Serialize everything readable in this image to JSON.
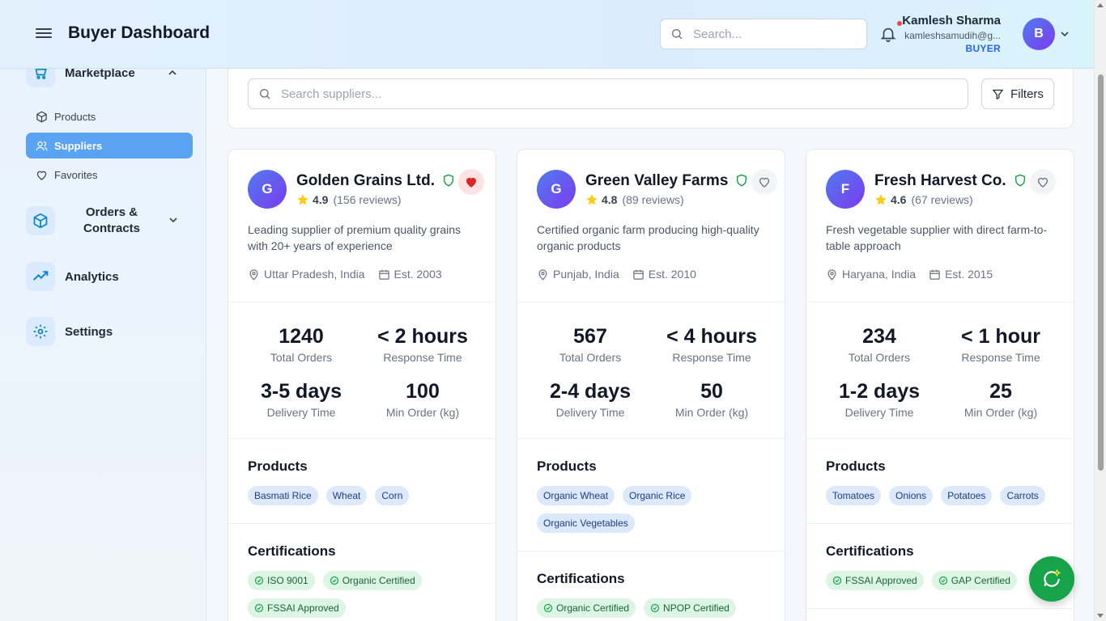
{
  "header": {
    "title": "Buyer Dashboard",
    "search_placeholder": "Search...",
    "user": {
      "name": "Kamlesh Sharma",
      "email": "kamleshsamudih@g...",
      "role": "BUYER",
      "initial": "B"
    }
  },
  "sidebar": {
    "marketplace": "Marketplace",
    "sub_items": [
      {
        "label": "Products"
      },
      {
        "label": "Suppliers"
      },
      {
        "label": "Favorites"
      }
    ],
    "orders_line1": "Orders &",
    "orders_line2": "Contracts",
    "analytics": "Analytics",
    "settings": "Settings"
  },
  "main": {
    "search_placeholder": "Search suppliers...",
    "filters_label": "Filters",
    "suppliers": [
      {
        "initial": "G",
        "name": "Golden Grains Ltd.",
        "rating": "4.9",
        "reviews": "(156 reviews)",
        "description": "Leading supplier of premium quality grains with 20+ years of experience",
        "location": "Uttar Pradesh, India",
        "established": "Est. 2003",
        "favorited": true,
        "stats": [
          {
            "value": "1240",
            "label": "Total Orders"
          },
          {
            "value": "< 2 hours",
            "label": "Response Time"
          },
          {
            "value": "3-5 days",
            "label": "Delivery Time"
          },
          {
            "value": "100",
            "label": "Min Order (kg)"
          }
        ],
        "products_title": "Products",
        "products": [
          "Basmati Rice",
          "Wheat",
          "Corn"
        ],
        "certifications_title": "Certifications",
        "certifications": [
          "ISO 9001",
          "Organic Certified",
          "FSSAI Approved"
        ]
      },
      {
        "initial": "G",
        "name": "Green Valley Farms",
        "rating": "4.8",
        "reviews": "(89 reviews)",
        "description": "Certified organic farm producing high-quality organic products",
        "location": "Punjab, India",
        "established": "Est. 2010",
        "favorited": false,
        "stats": [
          {
            "value": "567",
            "label": "Total Orders"
          },
          {
            "value": "< 4 hours",
            "label": "Response Time"
          },
          {
            "value": "2-4 days",
            "label": "Delivery Time"
          },
          {
            "value": "50",
            "label": "Min Order (kg)"
          }
        ],
        "products_title": "Products",
        "products": [
          "Organic Wheat",
          "Organic Rice",
          "Organic Vegetables"
        ],
        "certifications_title": "Certifications",
        "certifications": [
          "Organic Certified",
          "NPOP Certified"
        ]
      },
      {
        "initial": "F",
        "name": "Fresh Harvest Co.",
        "rating": "4.6",
        "reviews": "(67 reviews)",
        "description": "Fresh vegetable supplier with direct farm-to-table approach",
        "location": "Haryana, India",
        "established": "Est. 2015",
        "favorited": false,
        "stats": [
          {
            "value": "234",
            "label": "Total Orders"
          },
          {
            "value": "< 1 hour",
            "label": "Response Time"
          },
          {
            "value": "1-2 days",
            "label": "Delivery Time"
          },
          {
            "value": "25",
            "label": "Min Order (kg)"
          }
        ],
        "products_title": "Products",
        "products": [
          "Tomatoes",
          "Onions",
          "Potatoes",
          "Carrots"
        ],
        "certifications_title": "Certifications",
        "certifications": [
          "FSSAI Approved",
          "GAP Certified"
        ]
      }
    ]
  },
  "colors": {
    "accent": "#5aa3f2",
    "brand_gradient_start": "#4f7cf0",
    "brand_gradient_end": "#7c3aed",
    "fab": "#16a34a",
    "verified": "#16a34a",
    "favorite": "#dc2626"
  }
}
